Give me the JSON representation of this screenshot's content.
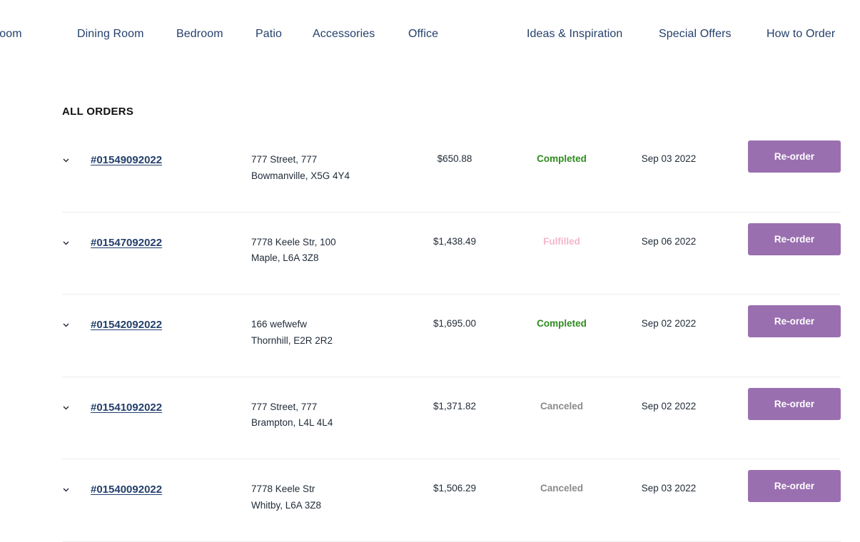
{
  "nav": {
    "left": [
      "ng Room",
      "Dining Room",
      "Bedroom",
      "Patio",
      "Accessories",
      "Office"
    ],
    "right": [
      "Ideas & Inspiration",
      "Special Offers",
      "How to Order"
    ]
  },
  "section": {
    "title": "ALL ORDERS"
  },
  "orders": [
    {
      "id": "#01549092022",
      "address_line1": "777 Street, 777",
      "address_line2": "Bowmanville, X5G 4Y4",
      "total": "$650.88",
      "status": "Completed",
      "date": "Sep 03 2022",
      "action": "Re-order"
    },
    {
      "id": "#01547092022",
      "address_line1": "7778 Keele Str, 100",
      "address_line2": "Maple, L6A 3Z8",
      "total": "$1,438.49",
      "status": "Fulfilled",
      "date": "Sep 06 2022",
      "action": "Re-order"
    },
    {
      "id": "#01542092022",
      "address_line1": "166 wefwefw",
      "address_line2": "Thornhill, E2R 2R2",
      "total": "$1,695.00",
      "status": "Completed",
      "date": "Sep 02 2022",
      "action": "Re-order"
    },
    {
      "id": "#01541092022",
      "address_line1": "777 Street, 777",
      "address_line2": "Brampton, L4L 4L4",
      "total": "$1,371.82",
      "status": "Canceled",
      "date": "Sep 02 2022",
      "action": "Re-order"
    },
    {
      "id": "#01540092022",
      "address_line1": "7778 Keele Str",
      "address_line2": "Whitby, L6A 3Z8",
      "total": "$1,506.29",
      "status": "Canceled",
      "date": "Sep 03 2022",
      "action": "Re-order"
    }
  ],
  "icons": {
    "row_toggle": "chevron-down-icon"
  },
  "colors": {
    "nav_text": "#243f6b",
    "status_completed": "#2e8b1f",
    "status_fulfilled": "#f2b8c9",
    "status_canceled": "#8a8a8a",
    "button_bg": "#9a6fb0"
  }
}
